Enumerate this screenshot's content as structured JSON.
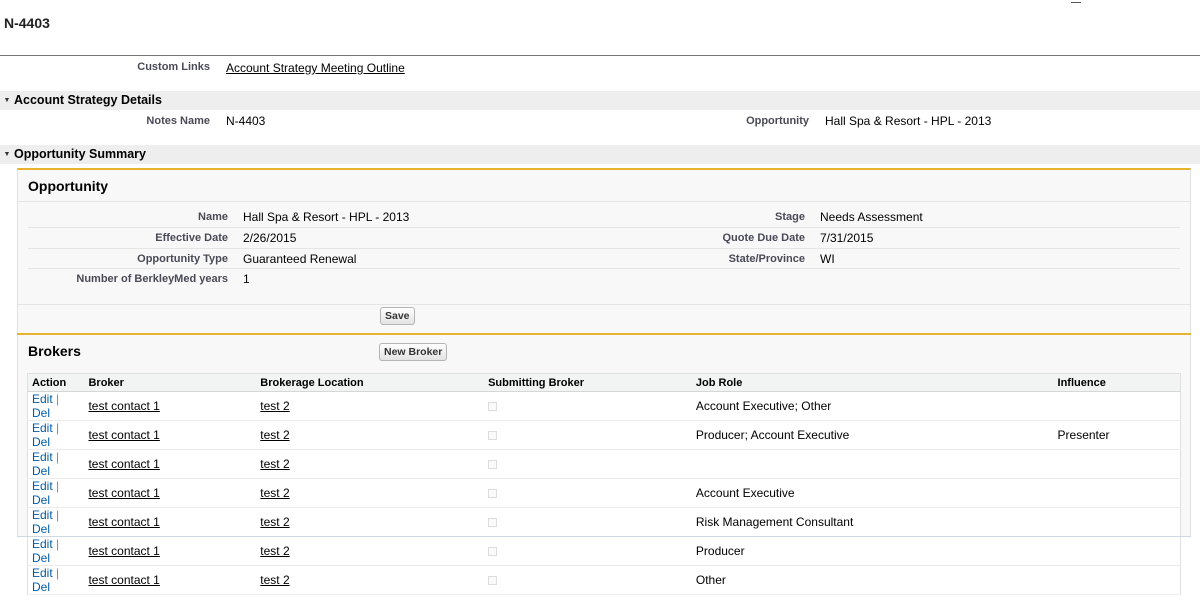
{
  "header": {
    "title": "N-4403"
  },
  "custom_links": {
    "label": "Custom Links",
    "link": "Account Strategy Meeting Outline"
  },
  "details_section": {
    "title": "Account Strategy Details",
    "notes_name_label": "Notes Name",
    "notes_name_value": "N-4403",
    "opportunity_label": "Opportunity",
    "opportunity_value": "Hall Spa & Resort - HPL - 2013"
  },
  "summary_section": {
    "title": "Opportunity Summary"
  },
  "opportunity": {
    "title": "Opportunity",
    "left_fields": [
      {
        "label": "Name",
        "value": "Hall Spa & Resort - HPL - 2013"
      },
      {
        "label": "Effective Date",
        "value": "2/26/2015"
      },
      {
        "label": "Opportunity Type",
        "value": "Guaranteed Renewal"
      },
      {
        "label": "Number of BerkleyMed years",
        "value": "1"
      }
    ],
    "right_fields": [
      {
        "label": "Stage",
        "value": "Needs Assessment"
      },
      {
        "label": "Quote Due Date",
        "value": "7/31/2015"
      },
      {
        "label": "State/Province",
        "value": "WI"
      }
    ],
    "save_label": "Save"
  },
  "brokers": {
    "title": "Brokers",
    "new_button": "New Broker",
    "columns": [
      "Action",
      "Broker",
      "Brokerage Location",
      "Submitting Broker",
      "Job Role",
      "Influence"
    ],
    "edit_label": "Edit",
    "separator": "|",
    "del_label": "Del",
    "rows": [
      {
        "broker": "test contact 1",
        "location": "test 2",
        "submitting": false,
        "job_role": "Account Executive; Other",
        "influence": ""
      },
      {
        "broker": "test contact 1",
        "location": "test 2",
        "submitting": false,
        "job_role": "Producer; Account Executive",
        "influence": "Presenter"
      },
      {
        "broker": "test contact 1",
        "location": "test 2",
        "submitting": false,
        "job_role": "",
        "influence": ""
      },
      {
        "broker": "test contact 1",
        "location": "test 2",
        "submitting": false,
        "job_role": "Account Executive",
        "influence": ""
      },
      {
        "broker": "test contact 1",
        "location": "test 2",
        "submitting": false,
        "job_role": "Risk Management Consultant",
        "influence": ""
      },
      {
        "broker": "test contact 1",
        "location": "test 2",
        "submitting": false,
        "job_role": "Producer",
        "influence": ""
      },
      {
        "broker": "test contact 1",
        "location": "test 2",
        "submitting": false,
        "job_role": "Other",
        "influence": ""
      }
    ]
  },
  "colors": {
    "accent": "#e8b42f",
    "link_blue": "#015ba7",
    "section_bg": "#eeeeee"
  }
}
